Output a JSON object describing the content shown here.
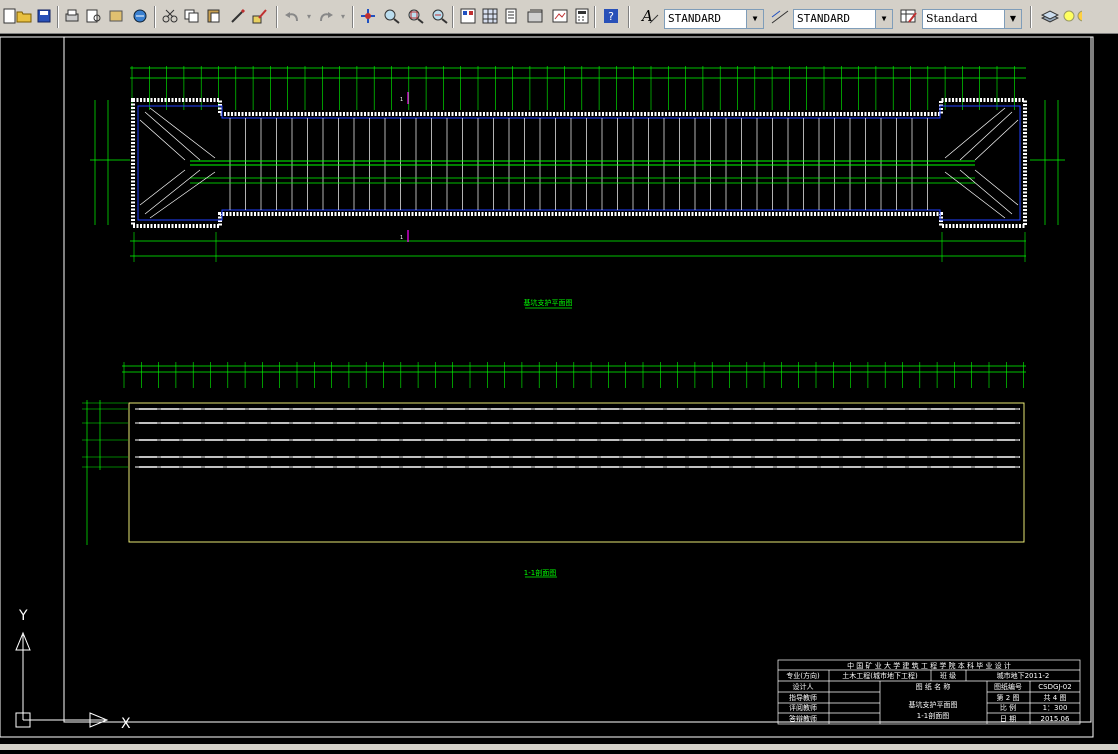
{
  "toolbar": {
    "icons": [
      "new-drawing-icon",
      "open-icon",
      "save-icon",
      "plot-icon",
      "plot-preview-icon",
      "publish-icon",
      "etransmit-icon",
      "cut-icon",
      "copy-icon",
      "paste-icon",
      "match-properties-icon",
      "block-editor-icon",
      "undo-icon",
      "redo-icon",
      "pan-icon",
      "zoom-realtime-icon",
      "zoom-window-icon",
      "zoom-previous-icon",
      "properties-icon",
      "design-center-icon",
      "tool-palettes-icon",
      "sheet-set-icon",
      "markup-icon",
      "calculator-icon",
      "help-icon",
      "text-style-icon",
      "dim-style-icon",
      "table-style-icon",
      "layer-manager-icon",
      "layer-state-icon"
    ],
    "text_style": "STANDARD",
    "dim_style": "STANDARD",
    "table_style": "Standard"
  },
  "drawing": {
    "plan_title": "基坑支护平面图",
    "section_title": "1-1剖面图",
    "section_mark_top": "1",
    "section_mark_bottom": "1",
    "ucs_x": "X",
    "ucs_y": "Y"
  },
  "title_block": {
    "header": "中 国 矿 业 大 学 建 筑 工 程 学 院 本 科 毕 业 设 计",
    "major_label": "专业(方向)",
    "major_value": "土木工程(城市地下工程)",
    "class_label": "班 级",
    "class_value": "城市地下2011-2",
    "designer_label": "设计人",
    "drawing_name_label": "图 纸 名 称",
    "drawing_no_label": "图纸编号",
    "drawing_no_value": "CSDGJ-02",
    "supervisor_label": "指导教师",
    "reviewer_label": "评阅教师",
    "defense_label": "答辩教师",
    "drawing_name_1": "基坑支护平面图",
    "drawing_name_2": "1-1剖面图",
    "sheet_no": "第 2 图",
    "sheet_total": "共 4 图",
    "scale_label": "比 例",
    "scale_value": "1：300",
    "date_label": "日 期",
    "date_value": "2015.06"
  },
  "colors": {
    "accent_green": "#00ff00",
    "yellow": "#ffff80",
    "blue": "#0000ff",
    "magenta": "#ff00ff"
  }
}
